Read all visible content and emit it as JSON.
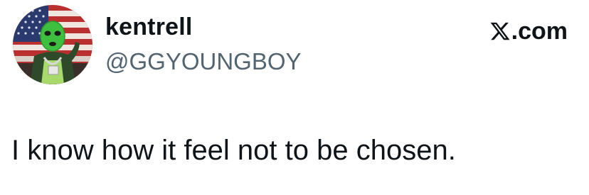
{
  "tweet": {
    "author": {
      "display_name": "kentrell",
      "handle": "@GGYOUNGBOY",
      "avatar_icon": "profile-photo-green-mask-flag"
    },
    "brand": {
      "icon": "x-logo-icon",
      "text": ".com"
    },
    "text": "I know how it feel not to be chosen."
  },
  "colors": {
    "text_primary": "#0f1419",
    "text_secondary": "#536471",
    "background": "#ffffff"
  }
}
